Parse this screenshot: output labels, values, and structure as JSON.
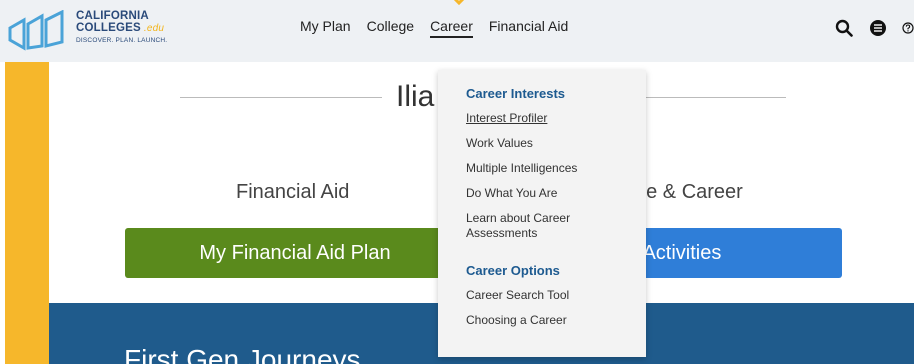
{
  "logo": {
    "line1": "CALIFORNIA",
    "line2": "COLLEGES",
    "edu": ".edu",
    "tagline": "DISCOVER. PLAN. LAUNCH."
  },
  "nav": {
    "items": [
      {
        "label": "My Plan"
      },
      {
        "label": "College"
      },
      {
        "label": "Career"
      },
      {
        "label": "Financial Aid"
      }
    ],
    "active": "Career"
  },
  "tools": {
    "search_icon": "search-icon",
    "menu_icon": "list-icon",
    "help_icon": "help-icon"
  },
  "hero": {
    "name_fragment": "Ilia"
  },
  "sections": {
    "financial_aid_heading": "Financial Aid",
    "college_career_heading_fragment": "ge & Career",
    "financial_aid_button": "My Financial Aid Plan",
    "activities_button_fragment": "y Activities",
    "journey_title_fragment": "First Gen Journeys"
  },
  "dropdown": {
    "career_interests": {
      "heading": "Career Interests",
      "items": [
        "Interest Profiler",
        "Work Values",
        "Multiple Intelligences",
        "Do What You Are",
        "Learn about Career Assessments"
      ]
    },
    "career_options": {
      "heading": "Career Options",
      "items": [
        "Career Search Tool",
        "Choosing a Career"
      ]
    }
  },
  "colors": {
    "header_bg": "#eef1f4",
    "brand_blue": "#2a4a7a",
    "accent_yellow": "#f6b72b",
    "green_button": "#5a8a1c",
    "blue_button": "#2f7ed8",
    "band_blue": "#1f5b8c",
    "dropdown_heading": "#1d5a90"
  }
}
